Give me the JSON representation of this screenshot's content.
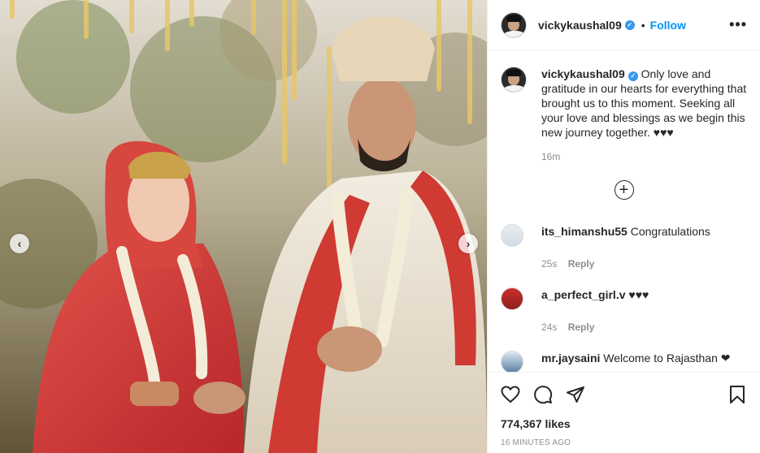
{
  "header": {
    "username": "vickykaushal09",
    "verified_icon": "verified-badge-icon",
    "separator": "•",
    "follow_label": "Follow",
    "more_icon": "more-options-icon"
  },
  "caption": {
    "username": "vickykaushal09",
    "text": "Only love and gratitude in our hearts for everything that brought us to this moment. Seeking all your love and blessings as we begin this new journey together. ♥♥♥",
    "time": "16m"
  },
  "load_more_icon": "plus-circle-icon",
  "comments": [
    {
      "username": "its_himanshu55",
      "text": "Congratulations",
      "time": "25s",
      "reply_label": "Reply"
    },
    {
      "username": "a_perfect_girl.v",
      "text": "♥♥♥",
      "time": "24s",
      "reply_label": "Reply"
    },
    {
      "username": "mr.jaysaini",
      "text": "Welcome to Rajasthan ❤",
      "time": "",
      "reply_label": ""
    }
  ],
  "actions": {
    "like_icon": "heart-icon",
    "comment_icon": "comment-icon",
    "share_icon": "share-icon",
    "save_icon": "bookmark-icon"
  },
  "likes": "774,367 likes",
  "posted": "16 MINUTES AGO",
  "carousel": {
    "prev_label": "‹",
    "next_label": "›"
  },
  "colors": {
    "accent": "#0095f6",
    "verified": "#3897f0",
    "muted": "#8e8e8e",
    "text": "#262626"
  }
}
